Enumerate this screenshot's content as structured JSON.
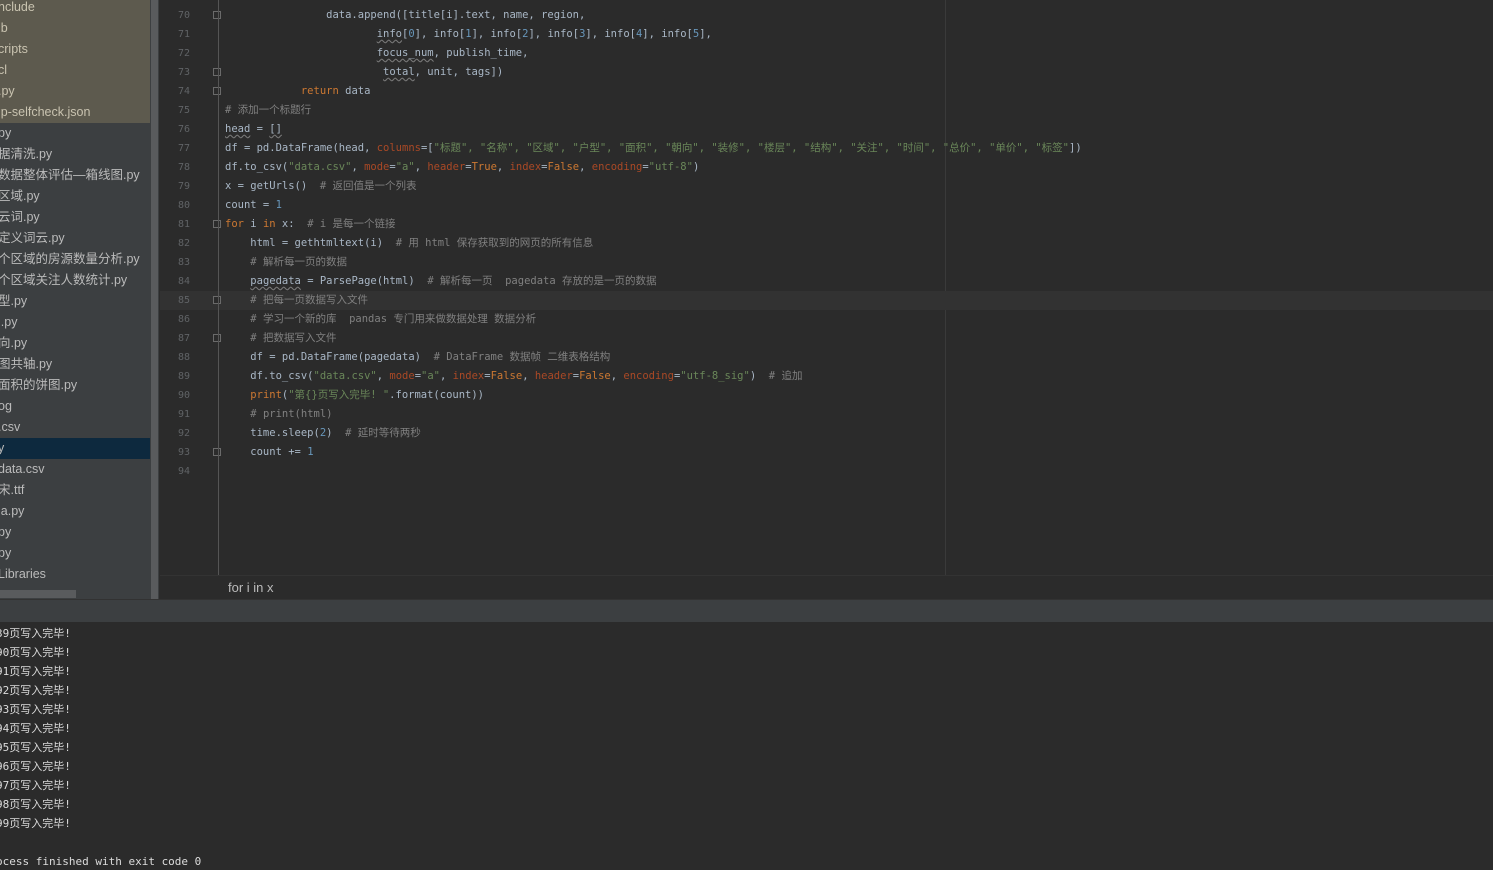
{
  "sidebar": {
    "items": [
      {
        "label": "nclude",
        "state": "excluded"
      },
      {
        "label": "ib",
        "state": "excluded"
      },
      {
        "label": "cripts",
        "state": "excluded"
      },
      {
        "label": "cl",
        "state": "excluded"
      },
      {
        "label": ".py",
        "state": "excluded"
      },
      {
        "label": "ip-selfcheck.json",
        "state": "excluded"
      },
      {
        "label": "py",
        "state": "normal"
      },
      {
        "label": "据清洗.py",
        "state": "normal"
      },
      {
        "label": "数据整体评估—箱线图.py",
        "state": "normal"
      },
      {
        "label": "区域.py",
        "state": "normal"
      },
      {
        "label": "云词.py",
        "state": "normal"
      },
      {
        "label": "定义词云.py",
        "state": "normal"
      },
      {
        "label": "个区域的房源数量分析.py",
        "state": "normal"
      },
      {
        "label": "个区域关注人数统计.py",
        "state": "normal"
      },
      {
        "label": "型.py",
        "state": "normal"
      },
      {
        "label": "j.py",
        "state": "normal"
      },
      {
        "label": "向.py",
        "state": "normal"
      },
      {
        "label": "图共轴.py",
        "state": "normal"
      },
      {
        "label": "面积的饼图.py",
        "state": "normal"
      },
      {
        "label": "og",
        "state": "normal"
      },
      {
        "label": ".csv",
        "state": "normal"
      },
      {
        "label": "y",
        "state": "selected"
      },
      {
        "label": "data.csv",
        "state": "normal"
      },
      {
        "label": "宋.ttf",
        "state": "normal"
      },
      {
        "label": "ia.py",
        "state": "normal"
      },
      {
        "label": "py",
        "state": "normal"
      },
      {
        "label": "py",
        "state": "normal"
      },
      {
        "label": " Libraries",
        "state": "normal"
      }
    ]
  },
  "editor": {
    "current_line": 85,
    "lines": [
      {
        "n": "70",
        "fold": true,
        "code": [
          [
            "",
            "                data.append([title[i].text, name, region,"
          ]
        ]
      },
      {
        "n": "71",
        "fold": false,
        "code": [
          [
            "",
            "                        "
          ],
          [
            "sq",
            "info"
          ],
          [
            "",
            "["
          ],
          [
            "num",
            "0"
          ],
          [
            "",
            "], info["
          ],
          [
            "num",
            "1"
          ],
          [
            "",
            "], info["
          ],
          [
            "num",
            "2"
          ],
          [
            "",
            "], info["
          ],
          [
            "num",
            "3"
          ],
          [
            "",
            "], info["
          ],
          [
            "num",
            "4"
          ],
          [
            "",
            "], info["
          ],
          [
            "num",
            "5"
          ],
          [
            "",
            "],"
          ]
        ]
      },
      {
        "n": "72",
        "fold": false,
        "code": [
          [
            "",
            "                        "
          ],
          [
            "sq",
            "focus_num"
          ],
          [
            "",
            ", publish_time,"
          ]
        ]
      },
      {
        "n": "73",
        "fold": true,
        "code": [
          [
            "",
            "                         "
          ],
          [
            "sq",
            "total"
          ],
          [
            "",
            ", unit, tags])"
          ]
        ]
      },
      {
        "n": "74",
        "fold": true,
        "code": [
          [
            "",
            "            "
          ],
          [
            "kw",
            "return"
          ],
          [
            "",
            " data"
          ]
        ]
      },
      {
        "n": "75",
        "fold": false,
        "code": [
          [
            "cm",
            "# 添加一个标题行"
          ]
        ]
      },
      {
        "n": "76",
        "fold": false,
        "code": [
          [
            "sq",
            "head"
          ],
          [
            "",
            " = "
          ],
          [
            "sq",
            "[]"
          ]
        ]
      },
      {
        "n": "77",
        "fold": false,
        "code": [
          [
            "",
            "df = pd.DataFrame(head, "
          ],
          [
            "prm",
            "columns"
          ],
          [
            "",
            "=["
          ],
          [
            "str",
            "\"标题\", \"名称\", \"区域\", \"户型\", \"面积\", \"朝向\", \"装修\", \"楼层\", \"结构\", \"关注\", \"时间\", \"总价\", \"单价\", \"标签\""
          ],
          [
            "",
            "])"
          ]
        ]
      },
      {
        "n": "78",
        "fold": false,
        "code": [
          [
            "",
            "df.to_csv("
          ],
          [
            "str",
            "\"data.csv\""
          ],
          [
            "",
            ", "
          ],
          [
            "prm",
            "mode"
          ],
          [
            "",
            "="
          ],
          [
            "str",
            "\"a\""
          ],
          [
            "",
            ", "
          ],
          [
            "prm",
            "header"
          ],
          [
            "",
            "="
          ],
          [
            "kw",
            "True"
          ],
          [
            "",
            ", "
          ],
          [
            "prm",
            "index"
          ],
          [
            "",
            "="
          ],
          [
            "kw",
            "False"
          ],
          [
            "",
            ", "
          ],
          [
            "prm",
            "encoding"
          ],
          [
            "",
            "="
          ],
          [
            "str",
            "\"utf-8\""
          ],
          [
            "",
            ")"
          ]
        ]
      },
      {
        "n": "79",
        "fold": false,
        "code": [
          [
            "",
            "x = getUrls()  "
          ],
          [
            "cm",
            "# 返回值是一个列表"
          ]
        ]
      },
      {
        "n": "80",
        "fold": false,
        "code": [
          [
            "",
            "count = "
          ],
          [
            "num",
            "1"
          ]
        ]
      },
      {
        "n": "81",
        "fold": true,
        "code": [
          [
            "kw",
            "for"
          ],
          [
            "",
            " i "
          ],
          [
            "kw",
            "in"
          ],
          [
            "",
            " x:  "
          ],
          [
            "cm",
            "# i 是每一个链接"
          ]
        ]
      },
      {
        "n": "82",
        "fold": false,
        "code": [
          [
            "",
            "    html = gethtmltext(i)  "
          ],
          [
            "cm",
            "# 用 html 保存获取到的网页的所有信息"
          ]
        ]
      },
      {
        "n": "83",
        "fold": false,
        "code": [
          [
            "",
            "    "
          ],
          [
            "cm",
            "# 解析每一页的数据"
          ]
        ]
      },
      {
        "n": "84",
        "fold": false,
        "code": [
          [
            "",
            "    "
          ],
          [
            "sq",
            "pagedata"
          ],
          [
            "",
            " = ParsePage(html)  "
          ],
          [
            "cm",
            "# 解析每一页  pagedata 存放的是一页的数据"
          ]
        ]
      },
      {
        "n": "85",
        "fold": true,
        "code": [
          [
            "",
            "    "
          ],
          [
            "cm",
            "# 把每一页数据写入文件"
          ]
        ]
      },
      {
        "n": "86",
        "fold": false,
        "code": [
          [
            "",
            "    "
          ],
          [
            "cm",
            "# 学习一个新的库  pandas 专门用来做数据处理 数据分析"
          ]
        ]
      },
      {
        "n": "87",
        "fold": true,
        "code": [
          [
            "",
            "    "
          ],
          [
            "cm",
            "# 把数据写入文件"
          ]
        ]
      },
      {
        "n": "88",
        "fold": false,
        "code": [
          [
            "",
            "    df = pd.DataFrame(pagedata)  "
          ],
          [
            "cm",
            "# DataFrame 数据帧 二维表格结构"
          ]
        ]
      },
      {
        "n": "89",
        "fold": false,
        "code": [
          [
            "",
            "    df.to_csv("
          ],
          [
            "str",
            "\"data.csv\""
          ],
          [
            "",
            ", "
          ],
          [
            "prm",
            "mode"
          ],
          [
            "",
            "="
          ],
          [
            "str",
            "\"a\""
          ],
          [
            "",
            ", "
          ],
          [
            "prm",
            "index"
          ],
          [
            "",
            "="
          ],
          [
            "kw",
            "False"
          ],
          [
            "",
            ", "
          ],
          [
            "prm",
            "header"
          ],
          [
            "",
            "="
          ],
          [
            "kw",
            "False"
          ],
          [
            "",
            ", "
          ],
          [
            "prm",
            "encoding"
          ],
          [
            "",
            "="
          ],
          [
            "str",
            "\"utf-8_sig\""
          ],
          [
            "",
            ")  "
          ],
          [
            "cm",
            "# 追加"
          ]
        ]
      },
      {
        "n": "90",
        "fold": false,
        "code": [
          [
            "",
            "    "
          ],
          [
            "kw",
            "print"
          ],
          [
            "",
            "("
          ],
          [
            "str",
            "\"第{}页写入完毕! \""
          ],
          [
            "",
            ".format(count))"
          ]
        ]
      },
      {
        "n": "91",
        "fold": false,
        "code": [
          [
            "",
            "    "
          ],
          [
            "cm",
            "# print(html)"
          ]
        ]
      },
      {
        "n": "92",
        "fold": false,
        "code": [
          [
            "",
            "    time.sleep("
          ],
          [
            "num",
            "2"
          ],
          [
            "",
            ")  "
          ],
          [
            "cm",
            "# 延时等待两秒"
          ]
        ]
      },
      {
        "n": "93",
        "fold": true,
        "code": [
          [
            "",
            "    count += "
          ],
          [
            "num",
            "1"
          ]
        ]
      },
      {
        "n": "94",
        "fold": false,
        "code": []
      }
    ]
  },
  "breadcrumb": {
    "text": "for i in x"
  },
  "run_output": {
    "lines": [
      "39页写入完毕!",
      "90页写入完毕!",
      "91页写入完毕!",
      "92页写入完毕!",
      "93页写入完毕!",
      "94页写入完毕!",
      "95页写入完毕!",
      "96页写入完毕!",
      "97页写入完毕!",
      "98页写入完毕!",
      "99页写入完毕!",
      "",
      "ocess finished with exit code 0"
    ]
  }
}
